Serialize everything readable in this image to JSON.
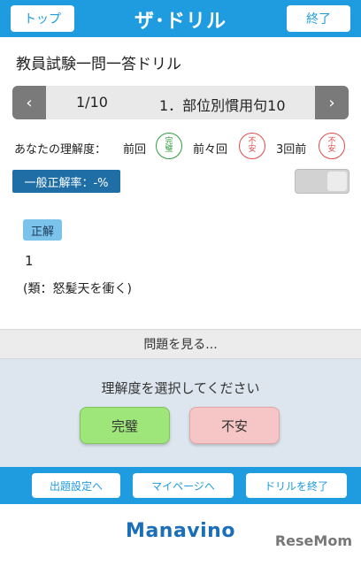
{
  "header": {
    "top_label": "トップ",
    "brand": "ザ･ドリル",
    "end_label": "終了"
  },
  "quiz": {
    "title": "教員試験一問一答ドリル"
  },
  "nav": {
    "prev": "‹",
    "counter": "1/10",
    "name": "1．部位別慣用句10",
    "next": "›"
  },
  "understanding": {
    "label": "あなたの理解度：",
    "history": [
      {
        "label": "前回",
        "stamp_top": "完",
        "stamp_bottom": "璧"
      },
      {
        "label": "前々回",
        "stamp_top": "不",
        "stamp_bottom": "安"
      },
      {
        "label": "3回前",
        "stamp_top": "不",
        "stamp_bottom": "安"
      }
    ]
  },
  "rate": {
    "label": "一般正解率：-%"
  },
  "answer": {
    "badge": "正解",
    "text": "1",
    "note": "(類：怒髪天を衝く)"
  },
  "show_question": "問題を見る...",
  "select": {
    "prompt": "理解度を選択してください",
    "perfect": "完璧",
    "unsure": "不安"
  },
  "footer_nav": {
    "settings": "出題設定へ",
    "mypage": "マイページへ",
    "end_drill": "ドリルを終了"
  },
  "footer": {
    "logo": "Manavino",
    "watermark": "ReseMom"
  },
  "colors": {
    "primary": "#1f9be0",
    "stamp_good": "#2f9e3e",
    "stamp_bad": "#e04b4b",
    "perfect_bg": "#9ee57a",
    "unsure_bg": "#f6c5c5"
  }
}
